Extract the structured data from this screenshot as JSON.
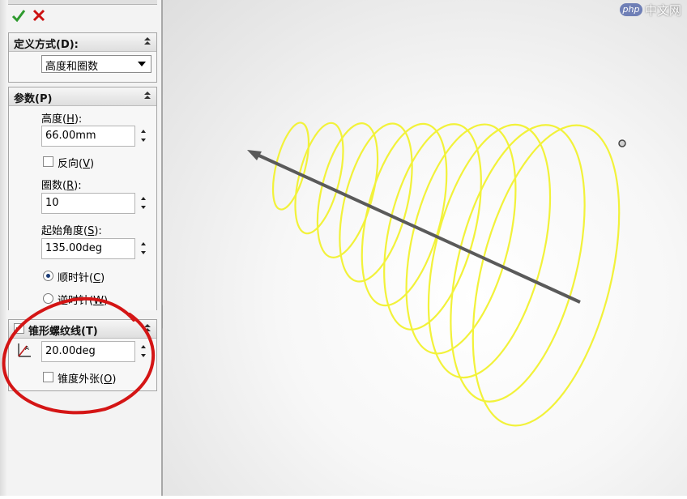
{
  "confirm": {
    "ok_icon": "checkmark-icon",
    "cancel_icon": "close-icon",
    "ok_color": "#2e9a2e",
    "cancel_color": "#cc1111"
  },
  "definition_group": {
    "title": "定义方式(D):",
    "combo_value": "高度和圈数"
  },
  "params_group": {
    "title": "参数(P)",
    "height_label_prefix": "高度(",
    "height_label_key": "H",
    "height_label_suffix": "):",
    "height_value": "66.00mm",
    "reverse_label_prefix": "反向(",
    "reverse_label_key": "V",
    "reverse_label_suffix": ")",
    "revolutions_label_prefix": "圈数(",
    "revolutions_label_key": "R",
    "revolutions_label_suffix": "):",
    "revolutions_value": "10",
    "start_angle_label_prefix": "起始角度(",
    "start_angle_label_key": "S",
    "start_angle_label_suffix": "):",
    "start_angle_value": "135.00deg",
    "clockwise_prefix": "顺时针(",
    "clockwise_key": "C",
    "clockwise_suffix": ")",
    "counterclockwise_prefix": "逆时针(",
    "counterclockwise_key": "W",
    "counterclockwise_suffix": ")"
  },
  "taper_group": {
    "title": "锥形螺纹线(T)",
    "angle_value": "20.00deg",
    "outward_prefix": "锥度外张(",
    "outward_key": "O",
    "outward_suffix": ")",
    "enabled": true
  },
  "watermark": {
    "logo": "php",
    "text": "中文网"
  },
  "colors": {
    "helix": "#f2f23a",
    "axis": "#5a5a5a",
    "annotation": "#d41515"
  }
}
